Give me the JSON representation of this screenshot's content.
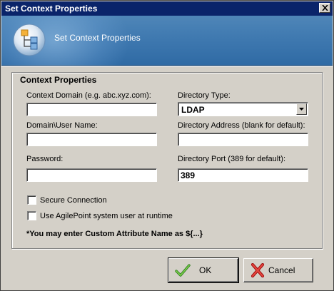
{
  "window": {
    "title": "Set Context Properties",
    "close_glyph": "✕"
  },
  "banner": {
    "title": "Set Context Properties",
    "icon": "context-hierarchy-icon"
  },
  "group": {
    "legend": "Context Properties"
  },
  "fields": {
    "context_domain": {
      "label": "Context Domain (e.g. abc.xyz.com):",
      "value": ""
    },
    "user_name": {
      "label": "Domain\\User Name:",
      "value": ""
    },
    "password": {
      "label": "Password:",
      "value": ""
    },
    "directory_type": {
      "label": "Directory Type:",
      "value": "LDAP"
    },
    "directory_address": {
      "label": "Directory Address (blank for default):",
      "value": ""
    },
    "directory_port": {
      "label": "Directory Port (389 for default):",
      "value": "389"
    }
  },
  "checkboxes": {
    "secure_connection": {
      "label": "Secure Connection",
      "checked": false
    },
    "use_system_user": {
      "label": "Use AgilePoint system user at runtime",
      "checked": false
    }
  },
  "note": "*You may enter Custom Attribute Name as ${...}",
  "buttons": {
    "ok": {
      "label": "OK",
      "icon": "checkmark-icon"
    },
    "cancel": {
      "label": "Cancel",
      "icon": "red-x-icon"
    }
  },
  "colors": {
    "titlebar": "#0a246a",
    "banner": "#3f79b0",
    "dialog": "#d4d0c8"
  }
}
